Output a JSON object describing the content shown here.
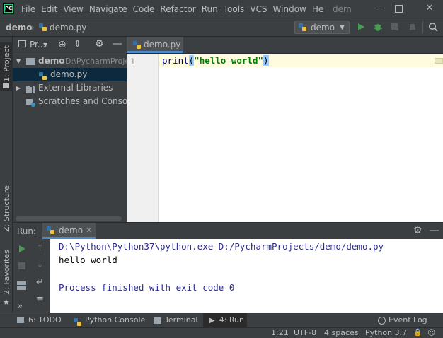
{
  "app": {
    "logo_text": "PC",
    "window_title": "dem"
  },
  "menu": [
    "File",
    "Edit",
    "View",
    "Navigate",
    "Code",
    "Refactor",
    "Run",
    "Tools",
    "VCS",
    "Window",
    "He"
  ],
  "navbar": {
    "project": "demo",
    "file": "demo.py",
    "run_config": "demo"
  },
  "left_strip": {
    "project_tab": "1: Project",
    "structure_tab": "Z: Structure",
    "favorites_tab": "2: Favorites"
  },
  "project_panel": {
    "title": "Pr...",
    "tree": [
      {
        "label": "demo",
        "path": "D:\\PycharmProje"
      },
      {
        "label": "demo.py"
      },
      {
        "label": "External Libraries"
      },
      {
        "label": "Scratches and Consoles"
      }
    ]
  },
  "editor": {
    "tab_label": "demo.py",
    "line_number": "1",
    "code": {
      "fn": "print",
      "open": "(",
      "string": "\"hello world\"",
      "close": ")"
    }
  },
  "run_panel": {
    "label": "Run:",
    "config": "demo",
    "output": [
      "D:\\Python\\Python37\\python.exe D:/PycharmProjects/demo/demo.py",
      "hello world",
      "",
      "Process finished with exit code 0"
    ]
  },
  "bottom_tabs": {
    "todo": "6: TODO",
    "python_console": "Python Console",
    "terminal": "Terminal",
    "run": "4: Run",
    "event_log": "Event Log"
  },
  "status": {
    "position": "1:21",
    "encoding": "UTF-8",
    "indent": "4 spaces",
    "interpreter": "Python 3.7"
  },
  "colors": {
    "accent": "#4a88c7",
    "run_green": "#499c54",
    "console_text": "#2b2b8a"
  }
}
